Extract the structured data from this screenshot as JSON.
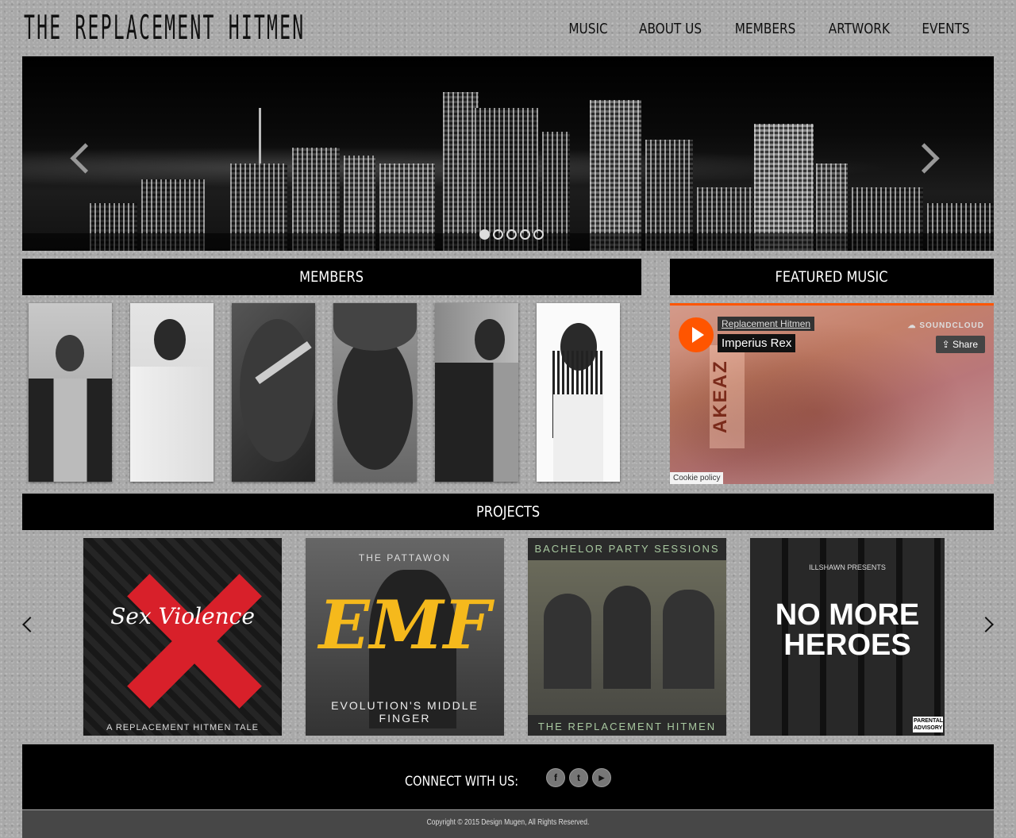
{
  "header": {
    "logo_text": "THE REPLACEMENT HITMEN",
    "nav": [
      {
        "label": "MUSIC"
      },
      {
        "label": "ABOUT US"
      },
      {
        "label": "MEMBERS"
      },
      {
        "label": "ARTWORK"
      },
      {
        "label": "EVENTS"
      }
    ]
  },
  "slider": {
    "slide_count": 5,
    "active_slide": 1,
    "prev_icon": "chevron-left-icon",
    "next_icon": "chevron-right-icon"
  },
  "members": {
    "heading": "MEMBERS",
    "photo_count": 6
  },
  "featured_music": {
    "heading": "FEATURED MUSIC",
    "player": {
      "artist": "Replacement Hitmen",
      "track": "Imperius Rex",
      "brand": "SOUNDCLOUD",
      "share_label": "Share",
      "cookie_label": "Cookie policy",
      "art_text": "AKEAZ",
      "accent_color": "#ff5500"
    }
  },
  "projects": {
    "heading": "PROJECTS",
    "items": [
      {
        "top_text": "",
        "title_text": "Sex Violence",
        "bottom_text": "A REPLACEMENT HITMEN TALE"
      },
      {
        "top_text": "THE PATTAWON",
        "title_text": "EMF",
        "bottom_text": "EVOLUTION'S MIDDLE FINGER"
      },
      {
        "top_text": "BACHELOR PARTY SESSIONS",
        "title_text": "",
        "bottom_text": "THE REPLACEMENT HITMEN"
      },
      {
        "top_text": "ILLSHAWN PRESENTS",
        "title_text": "NO MORE HEROES",
        "bottom_text": "PARENTAL ADVISORY"
      }
    ]
  },
  "footer": {
    "connect_label": "CONNECT WITH US:",
    "social": [
      {
        "icon": "facebook-icon",
        "glyph": "f"
      },
      {
        "icon": "twitter-icon",
        "glyph": "t"
      },
      {
        "icon": "youtube-icon",
        "glyph": "▶"
      }
    ],
    "copyright": "Copyright © 2015 Design Mugen, All Rights Reserved."
  }
}
